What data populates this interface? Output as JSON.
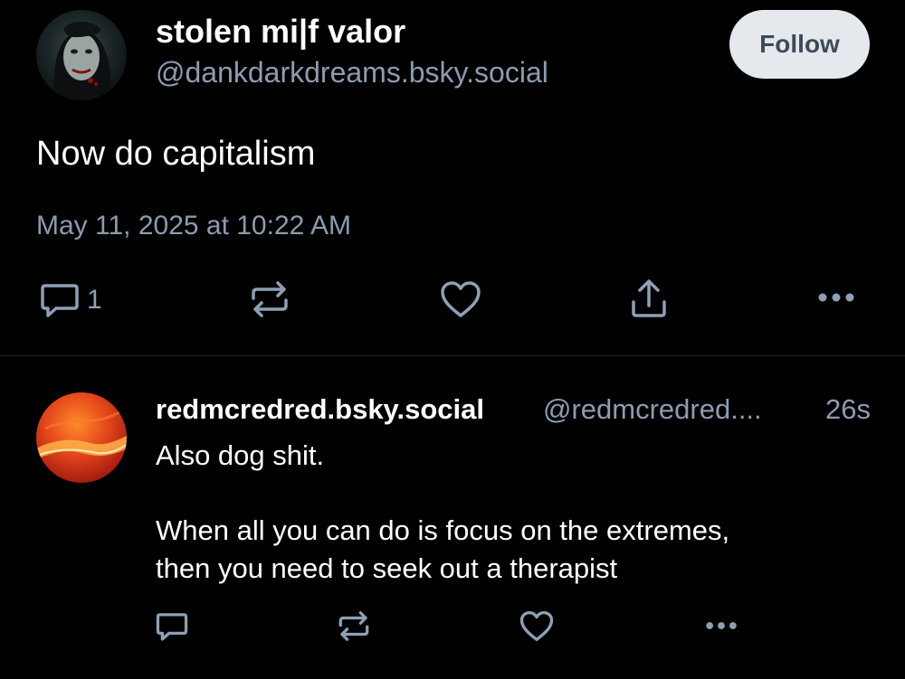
{
  "post": {
    "display_name": "stolen mi|f valor",
    "handle": "@dankdarkdreams.bsky.social",
    "follow_label": "Follow",
    "text": "Now do capitalism",
    "timestamp": "May 11, 2025 at 10:22 AM",
    "reply_count": "1",
    "icons": [
      "reply-icon",
      "repost-icon",
      "like-icon",
      "share-icon",
      "more-icon"
    ]
  },
  "reply": {
    "display_name": "redmcredred.bsky.social",
    "handle": "@redmcredred....",
    "time": "26s",
    "lines": [
      "Also dog shit.",
      "When all you can do is focus on the extremes,",
      "then you need to seek out a therapist"
    ],
    "icons": [
      "reply-icon",
      "repost-icon",
      "like-icon",
      "more-icon"
    ]
  },
  "colors": {
    "background": "#000000",
    "text": "#ffffff",
    "muted": "#8c9cb0",
    "icon": "#8ea0b5",
    "follow_bg": "#e5e9ee",
    "follow_text": "#3e4a5a"
  }
}
